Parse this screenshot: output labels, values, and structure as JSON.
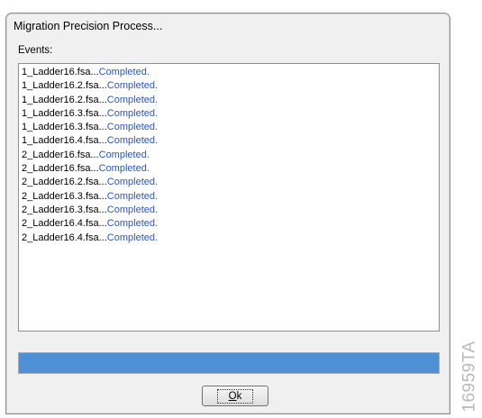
{
  "window": {
    "title": "Migration Precision Process..."
  },
  "events_label": "Events:",
  "events": [
    {
      "file": "1_Ladder16.fsa...",
      "status": "Completed."
    },
    {
      "file": "1_Ladder16.2.fsa...",
      "status": "Completed."
    },
    {
      "file": "1_Ladder16.2.fsa...",
      "status": "Completed."
    },
    {
      "file": "1_Ladder16.3.fsa...",
      "status": "Completed."
    },
    {
      "file": "1_Ladder16.3.fsa...",
      "status": "Completed."
    },
    {
      "file": "1_Ladder16.4.fsa...",
      "status": "Completed."
    },
    {
      "file": "2_Ladder16.fsa...",
      "status": "Completed."
    },
    {
      "file": "2_Ladder16.fsa...",
      "status": "Completed."
    },
    {
      "file": "2_Ladder16.2.fsa...",
      "status": "Completed."
    },
    {
      "file": "2_Ladder16.3.fsa...",
      "status": "Completed."
    },
    {
      "file": "2_Ladder16.3.fsa...",
      "status": "Completed."
    },
    {
      "file": "2_Ladder16.4.fsa...",
      "status": "Completed."
    },
    {
      "file": "2_Ladder16.4.fsa...",
      "status": "Completed."
    }
  ],
  "progress": {
    "fraction": 1.0,
    "color": "#4f8fd3"
  },
  "ok_button": {
    "accel": "O",
    "rest": "k"
  },
  "colors": {
    "status_text": "#2b57b3",
    "dialog_bg": "#f0f0f0"
  },
  "watermark": "16959TA"
}
